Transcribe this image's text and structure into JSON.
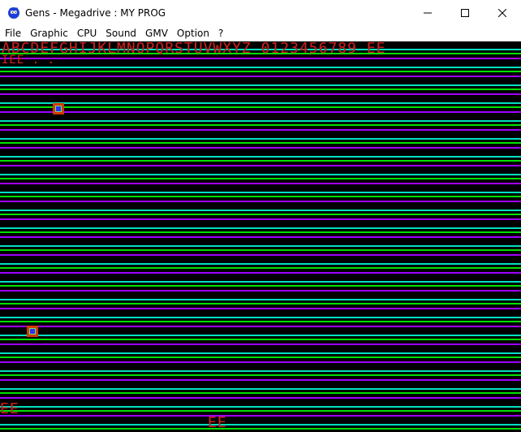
{
  "window": {
    "title": "Gens - Megadrive : MY PROG",
    "icon": "sonic-icon",
    "controls": {
      "minimize": "minimize-icon",
      "maximize": "maximize-icon",
      "close": "close-icon"
    }
  },
  "menu": {
    "items": [
      {
        "label": "File"
      },
      {
        "label": "Graphic"
      },
      {
        "label": "CPU"
      },
      {
        "label": "Sound"
      },
      {
        "label": "GMV"
      },
      {
        "label": "Option"
      },
      {
        "label": "?"
      }
    ]
  },
  "screen": {
    "font_row": "ABCDEFGHIJKLMNOPQRSTUVWXYZ 0123456789 EE",
    "row2": "IEE . .",
    "bottom_left": "EE",
    "bottom_center": "EE"
  },
  "colors": {
    "stripe_colors": [
      "#00e0c0",
      "#00e000",
      "#a000ff"
    ],
    "text": "#c8201c",
    "sprite_outer": "#d23b00",
    "sprite_inner": "#2f2fff"
  }
}
